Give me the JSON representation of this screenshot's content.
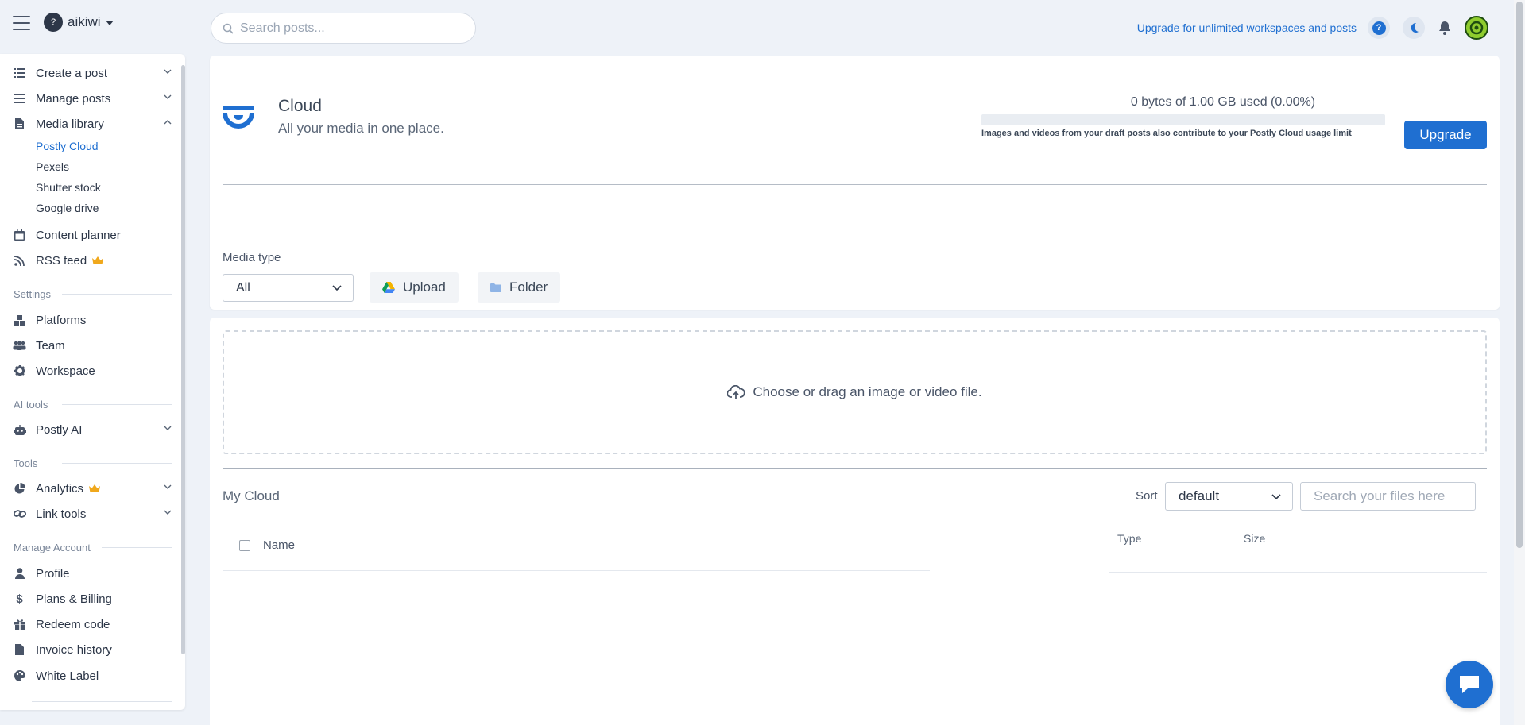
{
  "header": {
    "workspace_avatar": "?",
    "workspace_name": "aikiwi",
    "search_placeholder": "Search posts...",
    "upgrade_link": "Upgrade for unlimited workspaces and posts",
    "help_label": "?"
  },
  "sidebar": {
    "create_post": "Create a post",
    "manage_posts": "Manage posts",
    "media_library": "Media library",
    "media_sub": [
      "Postly Cloud",
      "Pexels",
      "Shutter stock",
      "Google drive"
    ],
    "content_planner": "Content planner",
    "rss_feed": "RSS feed",
    "settings_heading": "Settings",
    "platforms": "Platforms",
    "team": "Team",
    "workspace": "Workspace",
    "ai_tools_heading": "AI tools",
    "postly_ai": "Postly AI",
    "tools_heading": "Tools",
    "analytics": "Analytics",
    "link_tools": "Link tools",
    "manage_account_heading": "Manage Account",
    "profile": "Profile",
    "plans_billing": "Plans & Billing",
    "redeem_code": "Redeem code",
    "invoice_history": "Invoice history",
    "white_label": "White Label"
  },
  "cloud": {
    "title": "Cloud",
    "subtitle": "All your media in one place.",
    "usage_text": "0 bytes of 1.00 GB used (0.00%)",
    "usage_fraction": 0,
    "usage_note": "Images and videos from your draft posts also contribute to your Postly Cloud usage limit",
    "upgrade_button": "Upgrade",
    "media_type_label": "Media type",
    "media_type_value": "All",
    "upload_button": "Upload",
    "folder_button": "Folder"
  },
  "files": {
    "dropzone_text": "Choose or drag an image or video file.",
    "section_title": "My Cloud",
    "sort_label": "Sort",
    "sort_value": "default",
    "search_placeholder": "Search your files here",
    "columns": {
      "name": "Name",
      "type": "Type",
      "size": "Size"
    }
  },
  "colors": {
    "accent": "#1f6fd1",
    "crown": "#f0a81c"
  }
}
